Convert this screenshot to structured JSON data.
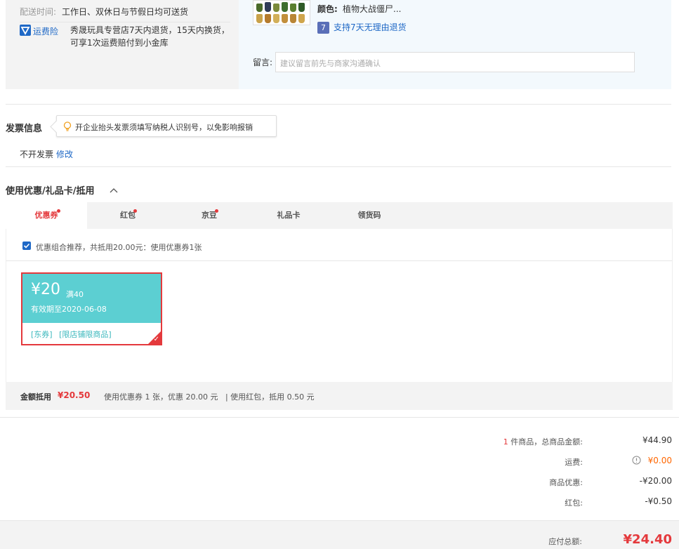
{
  "delivery": {
    "time_label": "配送时间:",
    "time_value": "工作日、双休日与节假日均可送货",
    "insurance_label": "运费险",
    "insurance_desc_line1": "秀晟玩具专营店7天内退货，15天内换货，",
    "insurance_desc_line2": "可享1次运费赔付到小金库"
  },
  "product": {
    "color_label": "颜色:",
    "color_value": "植物大战僵尸...",
    "return_badge": "7",
    "return_text": "支持7天无理由退货",
    "note_label": "留言:",
    "note_placeholder": "建议留言前先与商家沟通确认"
  },
  "invoice": {
    "title": "发票信息",
    "tip": "开企业抬头发票须填写纳税人识别号，以免影响报销",
    "status": "不开发票",
    "edit": "修改"
  },
  "discount": {
    "title": "使用优惠/礼品卡/抵用",
    "tabs": [
      "优惠券",
      "红包",
      "京豆",
      "礼品卡",
      "领货码"
    ],
    "recommend": "优惠组合推荐，共抵用20.00元：使用优惠券1张",
    "coupon": {
      "amount": "¥20",
      "condition": "满40",
      "expiry": "有效期至2020-06-08",
      "tag1": "[东券]",
      "tag2": "[限店铺限商品]"
    },
    "summary_label": "金额抵用",
    "summary_amount": "¥20.50",
    "summary_detail": "使用优惠券 1 张，优惠 20.00 元   | 使用红包，抵用 0.50 元"
  },
  "order": {
    "item_count": "1",
    "items_label": "件商品，总商品金额:",
    "items_value": "¥44.90",
    "shipping_label": "运费:",
    "shipping_value": "¥0.00",
    "promo_label": "商品优惠:",
    "promo_value": "-¥20.00",
    "redpack_label": "红包:",
    "redpack_value": "-¥0.50",
    "total_label": "应付总额:",
    "total_value": "¥24.40"
  },
  "colors": {
    "accent": "#e4393c",
    "link": "#1e68c6",
    "coupon": "#5ccfd2",
    "shipping": "#ff6600"
  }
}
